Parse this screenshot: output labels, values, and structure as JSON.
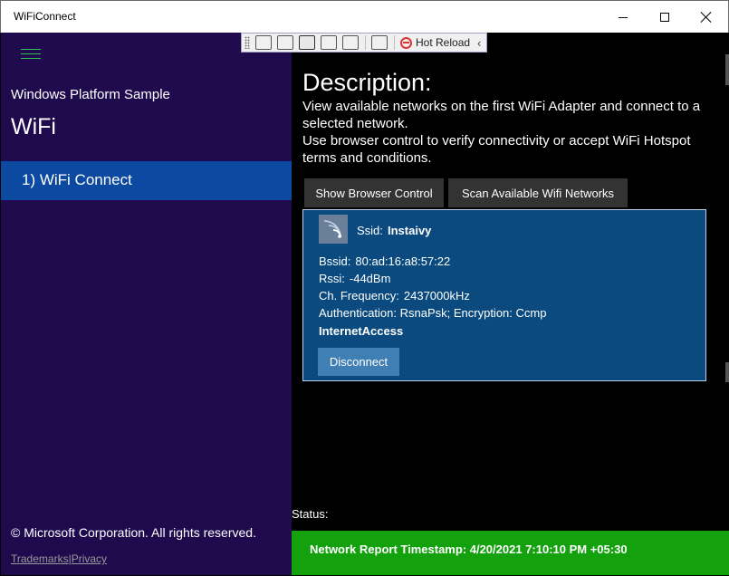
{
  "window": {
    "title": "WiFiConnect"
  },
  "debug_toolbar": {
    "hot_reload_label": "Hot Reload"
  },
  "sidebar": {
    "sample_title": "Windows Platform Sample",
    "scenario_title": "WiFi",
    "items": [
      {
        "label": "1) WiFi Connect"
      }
    ],
    "copyright": "© Microsoft Corporation. All rights reserved.",
    "trademarks_link": "Trademarks",
    "separator": "|",
    "privacy_link": "Privacy"
  },
  "main": {
    "description_heading": "Description:",
    "description_line1": "View available networks on the first WiFi Adapter and connect to a selected network.",
    "description_line2": "Use browser control to verify connectivity or accept WiFi Hotspot terms and conditions.",
    "show_browser_label": "Show Browser Control",
    "scan_label": "Scan Available Wifi Networks",
    "network": {
      "ssid_label": "Ssid:",
      "ssid": "Instaivy",
      "bssid_label": "Bssid:",
      "bssid": "80:ad:16:a8:57:22",
      "rssi_label": "Rssi:",
      "rssi": "-44dBm",
      "frequency_label": "Ch. Frequency:",
      "frequency": "2437000kHz",
      "security": "Authentication: RsnaPsk; Encryption: Ccmp",
      "connectivity": "InternetAccess",
      "disconnect_label": "Disconnect"
    },
    "status_label": "Status:",
    "status_message": "Network Report Timestamp: 4/20/2021 7:10:10 PM +05:30"
  },
  "colors": {
    "sidebar_bg": "#1f0a4e",
    "selected_item": "#0b4aa0",
    "card_bg": "#0b4a7e",
    "status_success": "#13a10e"
  }
}
